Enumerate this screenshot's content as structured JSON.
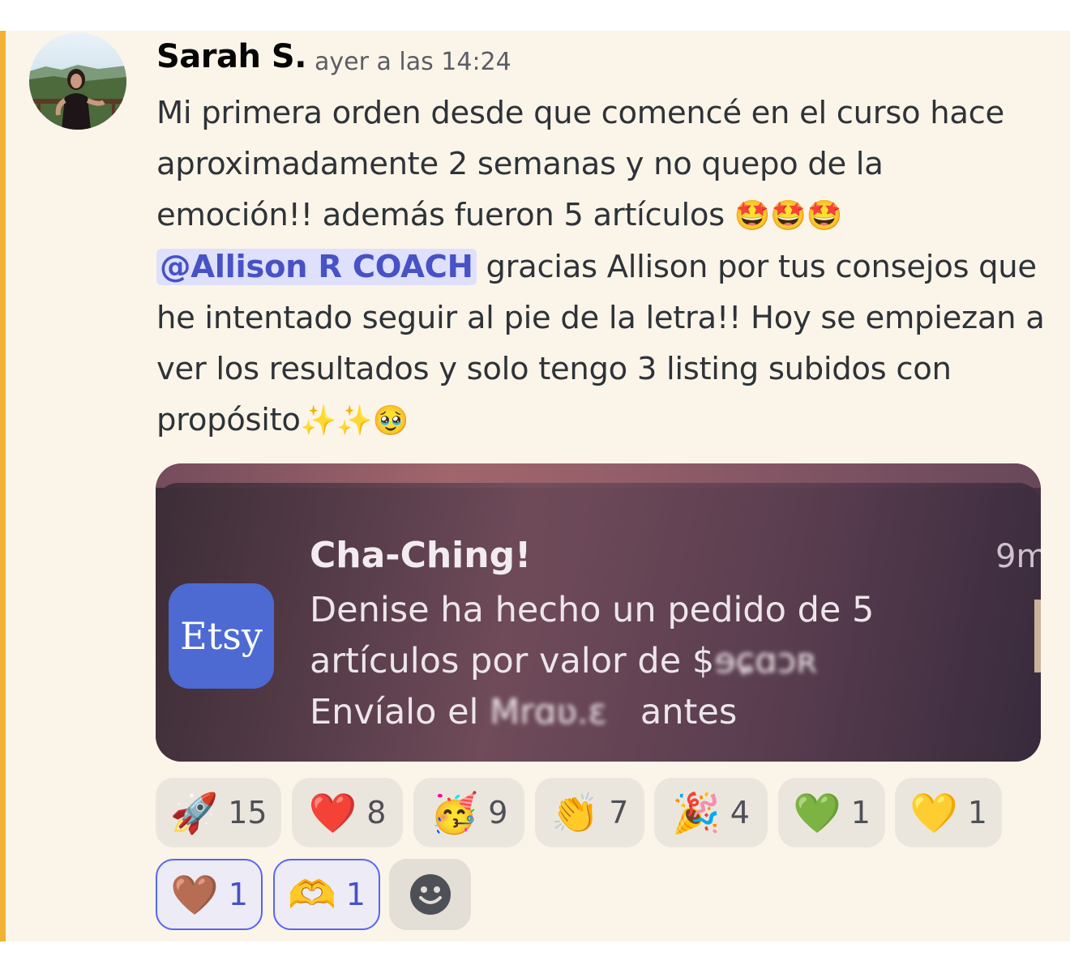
{
  "message": {
    "author": "Sarah S.",
    "timestamp": "ayer a las 14:24",
    "text_part1": "Mi primera orden desde que comencé en el curso hace aproximadamente 2 semanas y no quepo de la emoción!! además fueron 5 artículos ",
    "emoji_1": "🤩🤩🤩",
    "mention": "@Allison R COACH",
    "text_part2": " gracias Allison por tus consejos que he intentado seguir al pie de la letra!! Hoy se empiezan a ver los resultados y solo tengo 3 listing subidos con propósito",
    "emoji_2": "✨✨🥹"
  },
  "notification": {
    "app_icon_label": "Etsy",
    "title": "Cha-Ching!",
    "time": "9m",
    "line1": "Denise ha hecho un pedido de 5",
    "line2_prefix": "artículos por valor de $",
    "line2_redacted": "ɘɕɑɔʀ",
    "line3_prefix": "Envíalo el ",
    "line3_redacted": "Mrɑʋ.ɛ",
    "line3_suffix": "   antes"
  },
  "reactions": [
    {
      "emoji": "🚀",
      "count": "15"
    },
    {
      "emoji": "❤️",
      "count": "8"
    },
    {
      "emoji": "🥳",
      "count": "9"
    },
    {
      "emoji": "👏",
      "count": "7"
    },
    {
      "emoji": "🎉",
      "count": "4"
    },
    {
      "emoji": "💚",
      "count": "1"
    },
    {
      "emoji": "💛",
      "count": "1"
    },
    {
      "emoji": "🤎",
      "count": "1"
    },
    {
      "emoji": "🫶",
      "count": "1"
    }
  ],
  "icons": {
    "add_reaction": "smiley-face-icon"
  },
  "colors": {
    "highlight_bar": "#f0b232",
    "mention_bg": "#dee0fc",
    "mention_text": "#4752c4",
    "etsy_blue": "#4d6ad3",
    "message_bg": "#fbf5e9"
  }
}
